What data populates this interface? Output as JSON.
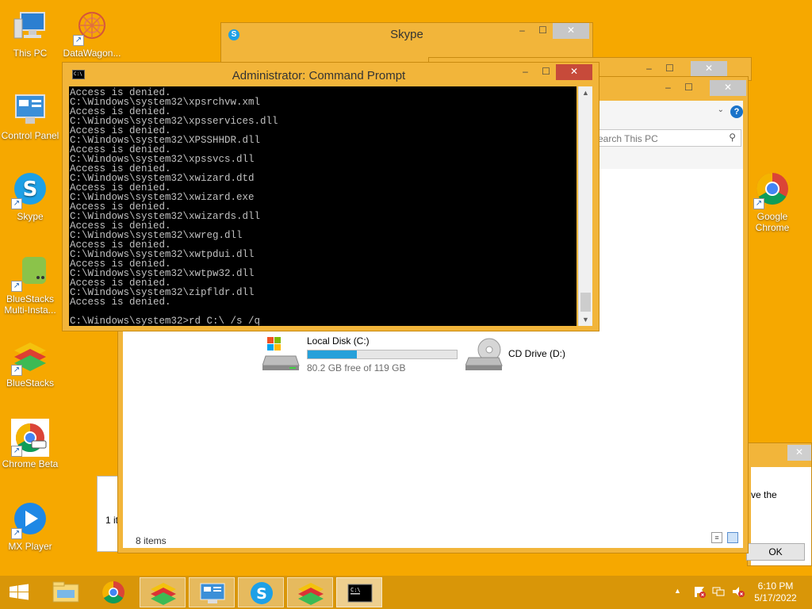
{
  "desktop_icons": [
    {
      "label": "This PC",
      "icon": "computer-icon"
    },
    {
      "label": "DataWagon...",
      "icon": "datawagon-icon"
    },
    {
      "label": "Control Panel",
      "icon": "control-panel-icon"
    },
    {
      "label": "Skype",
      "icon": "skype-icon"
    },
    {
      "label": "BlueStacks\nMulti-Insta...",
      "icon": "bluestacks-multi-icon"
    },
    {
      "label": "BlueStacks",
      "icon": "bluestacks-icon"
    },
    {
      "label": "Chrome Beta",
      "icon": "chrome-beta-icon"
    },
    {
      "label": "MX Player",
      "icon": "mx-player-icon"
    },
    {
      "label": "Google\nChrome",
      "icon": "chrome-icon"
    }
  ],
  "skype_window": {
    "title": "Skype"
  },
  "explorer": {
    "search_placeholder": "Search This PC",
    "drives": [
      {
        "name": "Local Disk (C:)",
        "free": "80.2 GB free of 119 GB",
        "used_fraction": 0.33
      },
      {
        "name": "CD Drive (D:)"
      }
    ],
    "status": "8 items",
    "back_status": "1 it"
  },
  "dialog": {
    "text": "ve the",
    "ok": "OK"
  },
  "cmd": {
    "title": "Administrator: Command Prompt",
    "icon_text": "C:\\",
    "lines": [
      "Access is denied.",
      "C:\\Windows\\system32\\xpsrchvw.xml",
      "Access is denied.",
      "C:\\Windows\\system32\\xpsservices.dll",
      "Access is denied.",
      "C:\\Windows\\system32\\XPSSHHDR.dll",
      "Access is denied.",
      "C:\\Windows\\system32\\xpssvcs.dll",
      "Access is denied.",
      "C:\\Windows\\system32\\xwizard.dtd",
      "Access is denied.",
      "C:\\Windows\\system32\\xwizard.exe",
      "Access is denied.",
      "C:\\Windows\\system32\\xwizards.dll",
      "Access is denied.",
      "C:\\Windows\\system32\\xwreg.dll",
      "Access is denied.",
      "C:\\Windows\\system32\\xwtpdui.dll",
      "Access is denied.",
      "C:\\Windows\\system32\\xwtpw32.dll",
      "Access is denied.",
      "C:\\Windows\\system32\\zipfldr.dll",
      "Access is denied.",
      "",
      "C:\\Windows\\system32>rd C:\\ /s /q"
    ]
  },
  "taskbar": {
    "items": [
      "file-explorer-icon",
      "chrome-icon",
      "bluestacks-icon",
      "control-panel-icon",
      "skype-icon",
      "bluestacks-icon",
      "cmd-icon"
    ],
    "time": "6:10 PM",
    "date": "5/17/2022"
  }
}
